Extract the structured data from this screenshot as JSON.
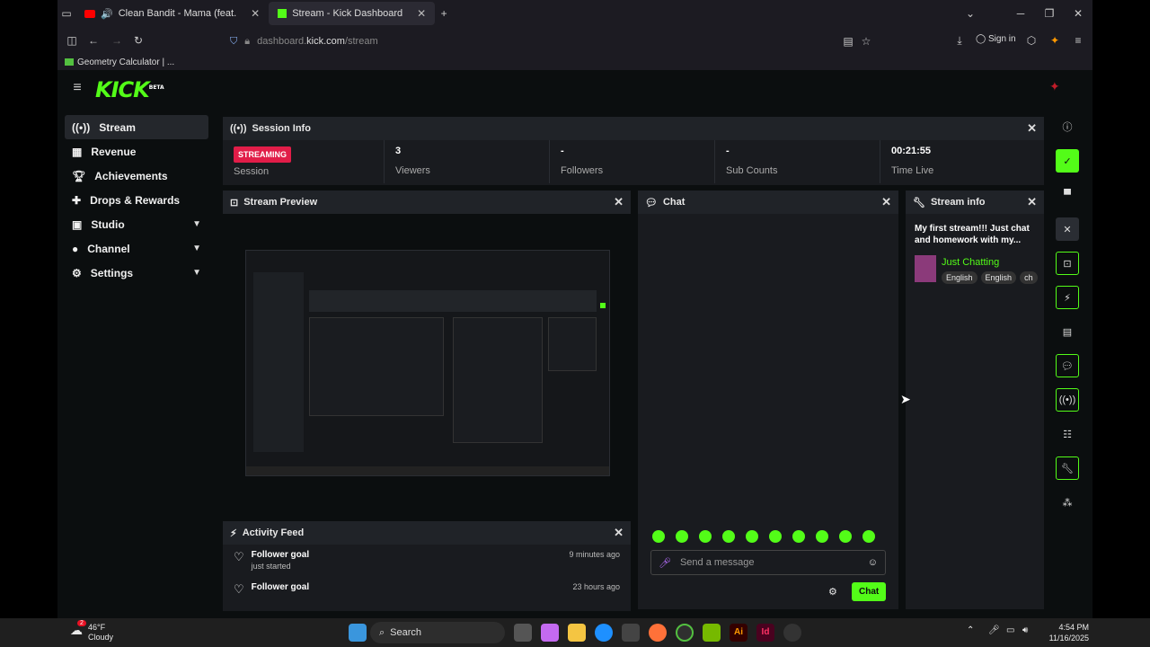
{
  "browser": {
    "tabs": [
      {
        "title": "Clean Bandit - Mama (feat.",
        "active": false
      },
      {
        "title": "Stream - Kick Dashboard",
        "active": true
      }
    ],
    "url_prefix": "dashboard.",
    "url_domain": "kick.com",
    "url_path": "/stream",
    "sign_in": "Sign in",
    "bookmark": "Geometry Calculator | ..."
  },
  "brand": {
    "logo": "KICK",
    "badge": "BETA",
    "accent": "#53fc18"
  },
  "sidebar": {
    "items": [
      {
        "label": "Stream",
        "icon": "broadcast-icon",
        "active": true
      },
      {
        "label": "Revenue",
        "icon": "chart-icon"
      },
      {
        "label": "Achievements",
        "icon": "trophy-icon"
      },
      {
        "label": "Drops & Rewards",
        "icon": "gift-icon"
      },
      {
        "label": "Studio",
        "icon": "studio-icon",
        "expandable": true
      },
      {
        "label": "Channel",
        "icon": "user-icon",
        "expandable": true
      },
      {
        "label": "Settings",
        "icon": "gear-icon",
        "expandable": true
      }
    ]
  },
  "session": {
    "title": "Session Info",
    "status": "STREAMING",
    "status_label": "Session",
    "viewers": "3",
    "viewers_label": "Viewers",
    "followers": "-",
    "followers_label": "Followers",
    "subs": "-",
    "subs_label": "Sub Counts",
    "time": "00:21:55",
    "time_label": "Time Live"
  },
  "preview": {
    "title": "Stream Preview"
  },
  "chat": {
    "title": "Chat",
    "placeholder": "Send a message",
    "send_label": "Chat",
    "emote_count": 10
  },
  "stream_info": {
    "title": "Stream info",
    "stream_title": "My first stream!!! Just chat and homework with my...",
    "category": "Just Chatting",
    "tags": [
      "English",
      "English",
      "ch"
    ]
  },
  "activity": {
    "title": "Activity Feed",
    "items": [
      {
        "title": "Follower goal",
        "subtitle": "just started",
        "ago": "9 minutes ago"
      },
      {
        "title": "Follower goal",
        "subtitle": "",
        "ago": "23 hours ago"
      }
    ]
  },
  "taskbar": {
    "weather_temp": "46°F",
    "weather_desc": "Cloudy",
    "notif_count": "2",
    "search": "Search",
    "time": "4:54 PM",
    "date": "11/16/2025"
  }
}
